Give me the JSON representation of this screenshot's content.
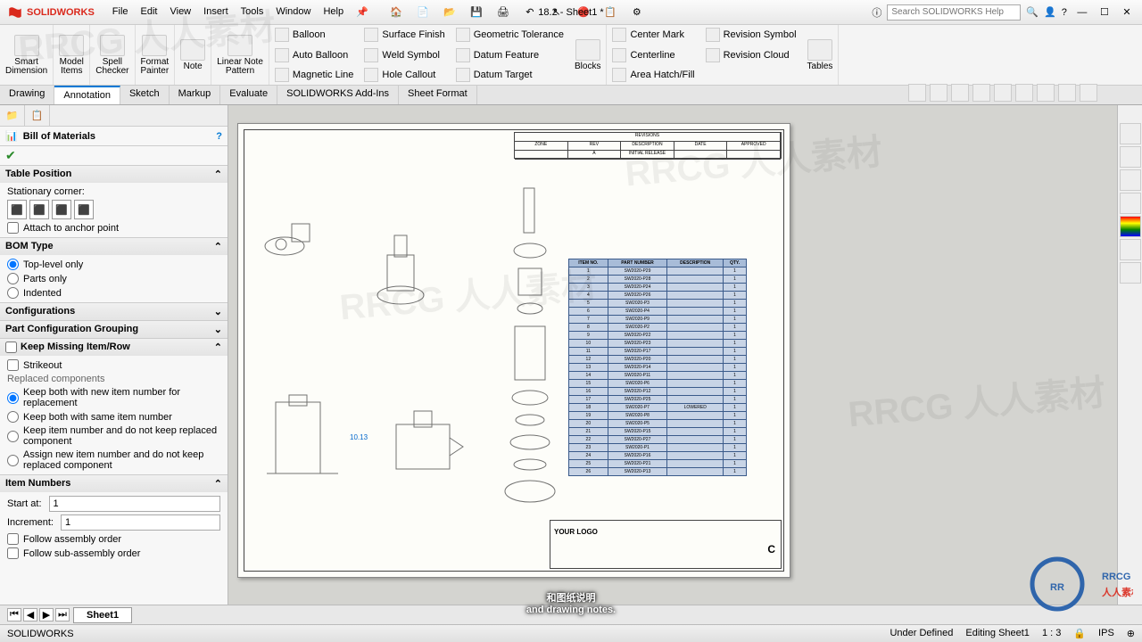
{
  "app": {
    "name": "SOLIDWORKS",
    "doc": "18.2 - Sheet1 *"
  },
  "menu": [
    "File",
    "Edit",
    "View",
    "Insert",
    "Tools",
    "Window",
    "Help"
  ],
  "search": {
    "placeholder": "Search SOLIDWORKS Help"
  },
  "ribbon": {
    "big": [
      {
        "label": "Smart\nDimension"
      },
      {
        "label": "Model\nItems"
      },
      {
        "label": "Spell\nChecker"
      },
      {
        "label": "Format\nPainter"
      },
      {
        "label": "Note"
      },
      {
        "label": "Linear Note\nPattern"
      }
    ],
    "col1": [
      "Balloon",
      "Auto Balloon",
      "Magnetic Line"
    ],
    "col2": [
      "Surface Finish",
      "Weld Symbol",
      "Hole Callout"
    ],
    "col3": [
      "Geometric Tolerance",
      "Datum Feature",
      "Datum Target"
    ],
    "blocks": "Blocks",
    "col4": [
      "Center Mark",
      "Centerline",
      "Area Hatch/Fill"
    ],
    "col5": [
      "Revision Symbol",
      "Revision Cloud",
      ""
    ],
    "tables": "Tables"
  },
  "cmtabs": [
    "Drawing",
    "Annotation",
    "Sketch",
    "Markup",
    "Evaluate",
    "SOLIDWORKS Add-Ins",
    "Sheet Format"
  ],
  "cmtabs_active": 1,
  "prop": {
    "title": "Bill of Materials",
    "sections": {
      "tablePos": {
        "h": "Table Position",
        "label": "Stationary corner:",
        "anchor": "Attach to anchor point"
      },
      "bomType": {
        "h": "BOM Type",
        "opts": [
          "Top-level only",
          "Parts only",
          "Indented"
        ],
        "sel": 0
      },
      "config": {
        "h": "Configurations"
      },
      "partGroup": {
        "h": "Part Configuration Grouping"
      },
      "keepMissing": {
        "h": "Keep Missing Item/Row",
        "strike": "Strikeout",
        "replaced": "Replaced components",
        "opts": [
          "Keep both with new item number for replacement",
          "Keep both with same item number",
          "Keep item number and do not keep replaced component",
          "Assign new item number and do not keep replaced component"
        ],
        "sel": 0
      },
      "itemNums": {
        "h": "Item Numbers",
        "start": "Start at:",
        "startVal": "1",
        "inc": "Increment:",
        "incVal": "1",
        "follow1": "Follow assembly order",
        "follow2": "Follow sub-assembly order"
      }
    }
  },
  "bom_table": {
    "headers": [
      "ITEM NO.",
      "PART NUMBER",
      "DESCRIPTION",
      "QTY."
    ],
    "rows": [
      [
        "1",
        "SW2020-P29",
        "",
        "1"
      ],
      [
        "2",
        "SW2020-P28",
        "",
        "1"
      ],
      [
        "3",
        "SW2020-P24",
        "",
        "1"
      ],
      [
        "4",
        "SW2020-P26",
        "",
        "1"
      ],
      [
        "5",
        "SW2020-P3",
        "",
        "1"
      ],
      [
        "6",
        "SW2020-P4",
        "",
        "1"
      ],
      [
        "7",
        "SW2020-P9",
        "",
        "1"
      ],
      [
        "8",
        "SW2020-P2",
        "",
        "1"
      ],
      [
        "9",
        "SW2020-P22",
        "",
        "1"
      ],
      [
        "10",
        "SW2020-P23",
        "",
        "1"
      ],
      [
        "11",
        "SW2020-P17",
        "",
        "1"
      ],
      [
        "12",
        "SW2020-P20",
        "",
        "1"
      ],
      [
        "13",
        "SW2020-P14",
        "",
        "1"
      ],
      [
        "14",
        "SW2020-P11",
        "",
        "1"
      ],
      [
        "15",
        "SW2020-P6",
        "",
        "1"
      ],
      [
        "16",
        "SW2020-P12",
        "",
        "1"
      ],
      [
        "17",
        "SW2020-P25",
        "",
        "1"
      ],
      [
        "18",
        "SW2020-P7",
        "LOWERED",
        "1"
      ],
      [
        "19",
        "SW2020-P8",
        "",
        "1"
      ],
      [
        "20",
        "SW2020-P5",
        "",
        "1"
      ],
      [
        "21",
        "SW2020-P15",
        "",
        "1"
      ],
      [
        "22",
        "SW2020-P27",
        "",
        "1"
      ],
      [
        "23",
        "SW2020-P1",
        "",
        "1"
      ],
      [
        "24",
        "SW2020-P16",
        "",
        "1"
      ],
      [
        "25",
        "SW2020-P21",
        "",
        "1"
      ],
      [
        "26",
        "SW2020-P13",
        "",
        "1"
      ]
    ]
  },
  "dim": "10.13",
  "titleblock": {
    "logo": "YOUR LOGO",
    "size": "C"
  },
  "sheettab": "Sheet1",
  "status": {
    "l": "SOLIDWORKS",
    "r": [
      "Under Defined",
      "Editing Sheet1",
      "1 : 3",
      "",
      "IPS",
      "⊕"
    ]
  },
  "subs": {
    "cn": "和图纸说明",
    "en": "and drawing notes."
  },
  "wm": "RRCG 人人素材"
}
